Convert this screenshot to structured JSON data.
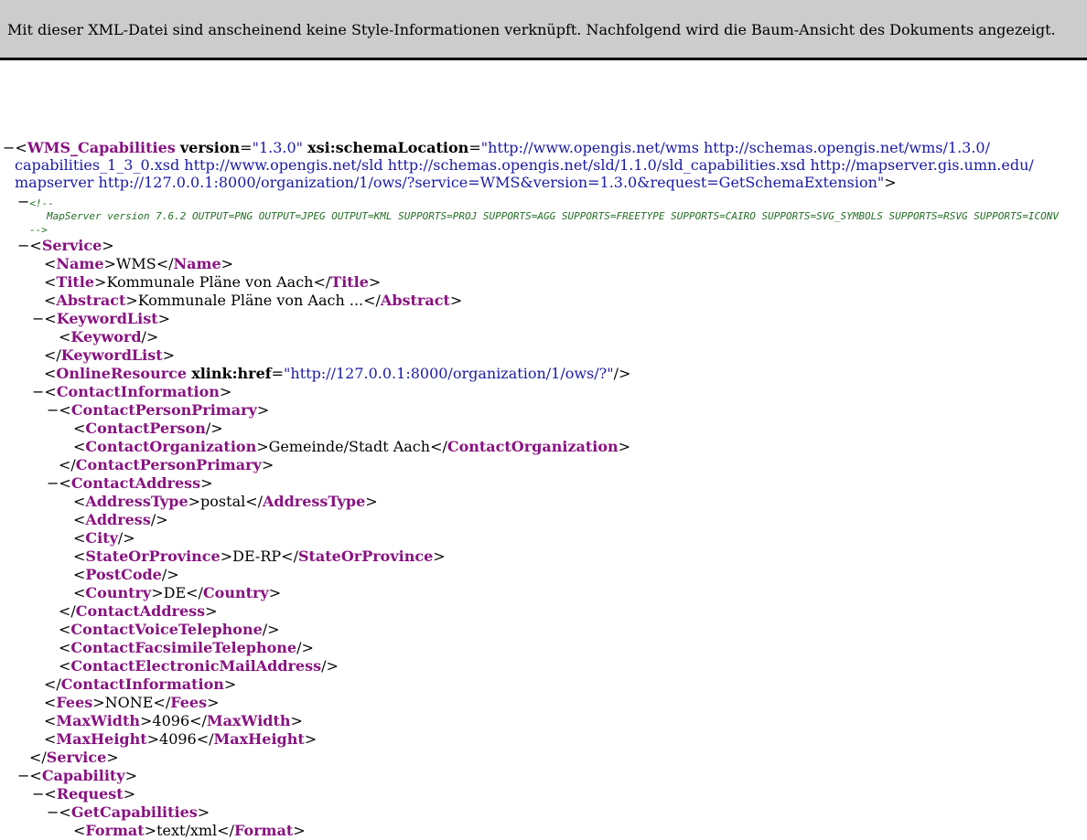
{
  "banner": {
    "message": "Mit dieser XML-Datei sind anscheinend keine Style-Informationen verknüpft. Nachfolgend wird die Baum-Ansicht des Dokuments angezeigt."
  },
  "toggle_symbol": "−",
  "root": {
    "tag": "WMS_Capabilities",
    "attr1_name": "version",
    "attr1_value": "\"1.3.0\"",
    "attr2_name": "xsi:schemaLocation",
    "attr2_value_line1": "\"http://www.opengis.net/wms http://schemas.opengis.net/wms/1.3.0/",
    "attr2_value_line2": "capabilities_1_3_0.xsd http://www.opengis.net/sld http://schemas.opengis.net/sld/1.1.0/sld_capabilities.xsd http://mapserver.gis.umn.edu/",
    "attr2_value_line3": "mapserver http://127.0.0.1:8000/organization/1/ows/?service=WMS&version=1.3.0&request=GetSchemaExtension\""
  },
  "comment": {
    "open": "<!--",
    "text": "MapServer version 7.6.2 OUTPUT=PNG OUTPUT=JPEG OUTPUT=KML SUPPORTS=PROJ SUPPORTS=AGG SUPPORTS=FREETYPE SUPPORTS=CAIRO SUPPORTS=SVG_SYMBOLS SUPPORTS=RSVG SUPPORTS=ICONV",
    "close": "-->"
  },
  "service": {
    "tag": "Service",
    "name_tag": "Name",
    "name_value": "WMS",
    "title_tag": "Title",
    "title_value": "Kommunale Pläne von Aach",
    "abstract_tag": "Abstract",
    "abstract_value": "Kommunale Pläne von Aach ...",
    "keywordlist_tag": "KeywordList",
    "keyword_tag": "Keyword",
    "onlineresource_tag": "OnlineResource",
    "onlineresource_attr": "xlink:href",
    "onlineresource_value": "\"http://127.0.0.1:8000/organization/1/ows/?\"",
    "contactinfo_tag": "ContactInformation",
    "contactpersonprimary_tag": "ContactPersonPrimary",
    "contactperson_tag": "ContactPerson",
    "contactorg_tag": "ContactOrganization",
    "contactorg_value": "Gemeinde/Stadt Aach",
    "contactaddress_tag": "ContactAddress",
    "addresstype_tag": "AddressType",
    "addresstype_value": "postal",
    "address_tag": "Address",
    "city_tag": "City",
    "state_tag": "StateOrProvince",
    "state_value": "DE-RP",
    "postcode_tag": "PostCode",
    "country_tag": "Country",
    "country_value": "DE",
    "voice_tag": "ContactVoiceTelephone",
    "fax_tag": "ContactFacsimileTelephone",
    "email_tag": "ContactElectronicMailAddress",
    "fees_tag": "Fees",
    "fees_value": "NONE",
    "maxwidth_tag": "MaxWidth",
    "maxwidth_value": "4096",
    "maxheight_tag": "MaxHeight",
    "maxheight_value": "4096"
  },
  "capability": {
    "tag": "Capability",
    "request_tag": "Request",
    "getcap_tag": "GetCapabilities",
    "format_tag": "Format",
    "format_value": "text/xml"
  }
}
